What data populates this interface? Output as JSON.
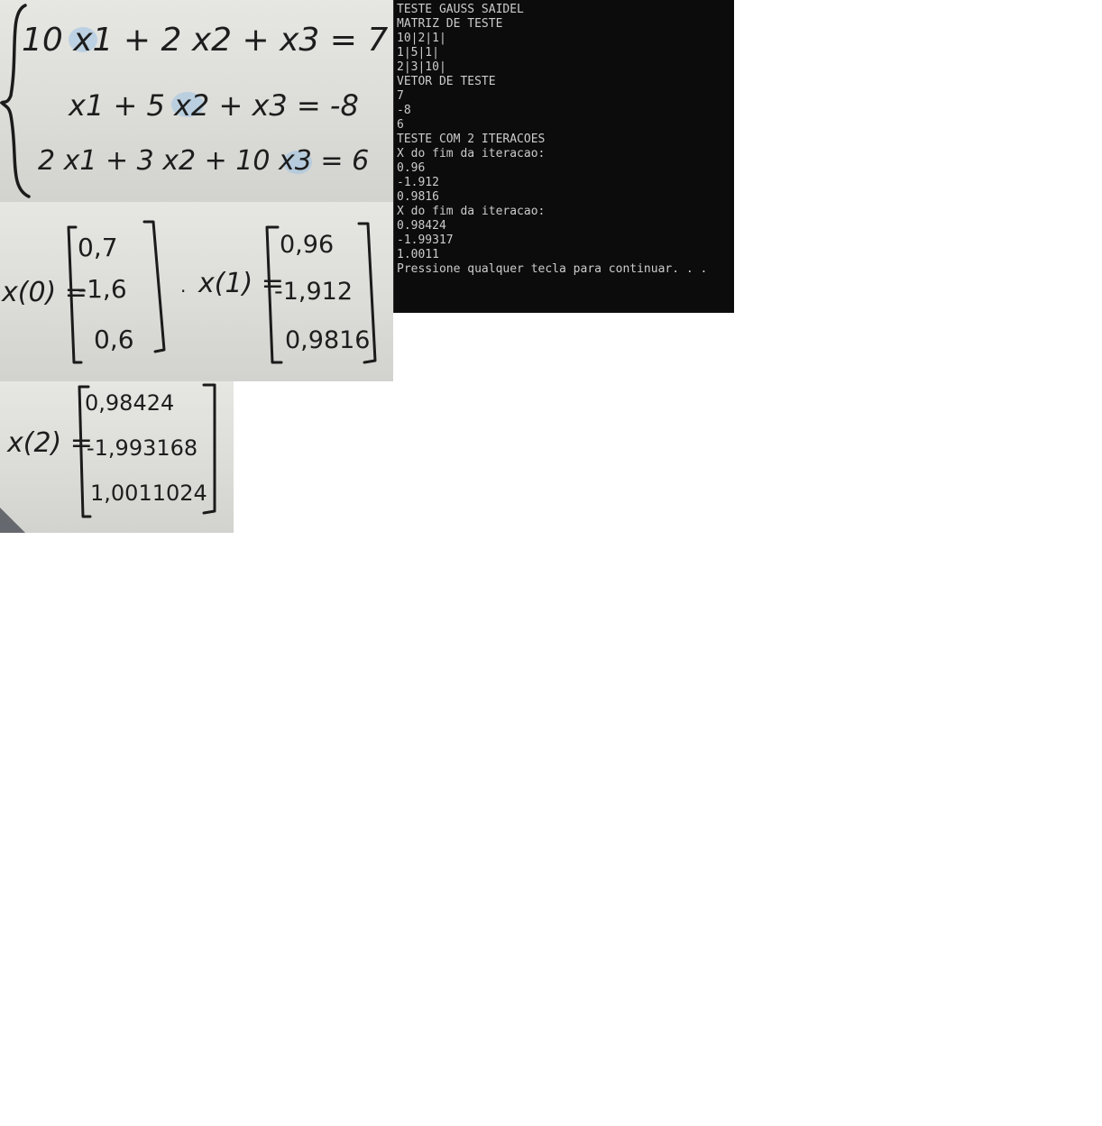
{
  "photo_equations": {
    "eq1": "10 x1 + 2 x2 + x3 = 7",
    "eq2": "x1 + 5 x2 + x3 = -8",
    "eq3": "2 x1 + 3 x2 + 10 x3 = 6"
  },
  "photo_x0_x1": {
    "x0_label": "x(0) =",
    "x0_values": [
      "0,7",
      "-1,6",
      "0,6"
    ],
    "x1_label": "x(1) =",
    "x1_values": [
      "0,96",
      "-1,912",
      "0,9816"
    ]
  },
  "photo_x2": {
    "x2_label": "x(2) =",
    "x2_values": [
      "0,98424",
      "-1,993168",
      "1,0011024"
    ]
  },
  "console": {
    "lines": [
      "TESTE GAUSS SAIDEL",
      "MATRIZ DE TESTE",
      "10|2|1|",
      "1|5|1|",
      "2|3|10|",
      "VETOR DE TESTE",
      "7",
      "-8",
      "6",
      "TESTE COM 2 ITERACOES",
      "X do fim da iteracao:",
      "0.96",
      "-1.912",
      "0.9816",
      "X do fim da iteracao:",
      "0.98424",
      "-1.99317",
      "1.0011",
      "Pressione qualquer tecla para continuar. . ."
    ]
  },
  "colors": {
    "console_bg": "#0c0c0c",
    "console_text": "#cccccc",
    "paper": "#dcdcd8",
    "highlight": "#9cc3e6"
  }
}
